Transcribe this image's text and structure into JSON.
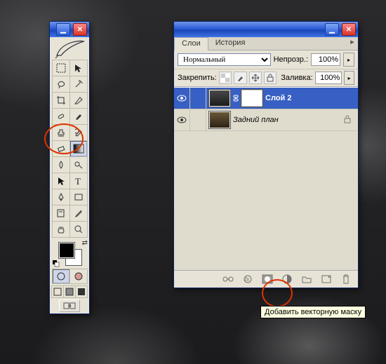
{
  "toolbox": {
    "tools": [
      "marquee",
      "move",
      "lasso",
      "wand",
      "crop",
      "slice",
      "healing",
      "brush",
      "stamp",
      "history-brush",
      "eraser",
      "gradient",
      "blur",
      "dodge",
      "path-select",
      "type",
      "pen",
      "shape",
      "notes",
      "eyedropper",
      "hand",
      "zoom"
    ]
  },
  "layers_panel": {
    "tab_layers": "Слои",
    "tab_history": "История",
    "blend_mode": "Нормальный",
    "opacity_label": "Непрозр.:",
    "opacity_value": "100%",
    "lock_label": "Закрепить:",
    "fill_label": "Заливка:",
    "fill_value": "100%",
    "layers": [
      {
        "name": "Слой 2",
        "active": true,
        "has_mask": true
      },
      {
        "name": "Задний план",
        "active": false,
        "locked": true
      }
    ],
    "tooltip": "Добавить векторную маску"
  },
  "colors": {
    "accent_blue": "#3860c4",
    "panel_bg": "#e7e3d6",
    "titlebar": "#2a5bd7",
    "red_circle": "#d30"
  }
}
